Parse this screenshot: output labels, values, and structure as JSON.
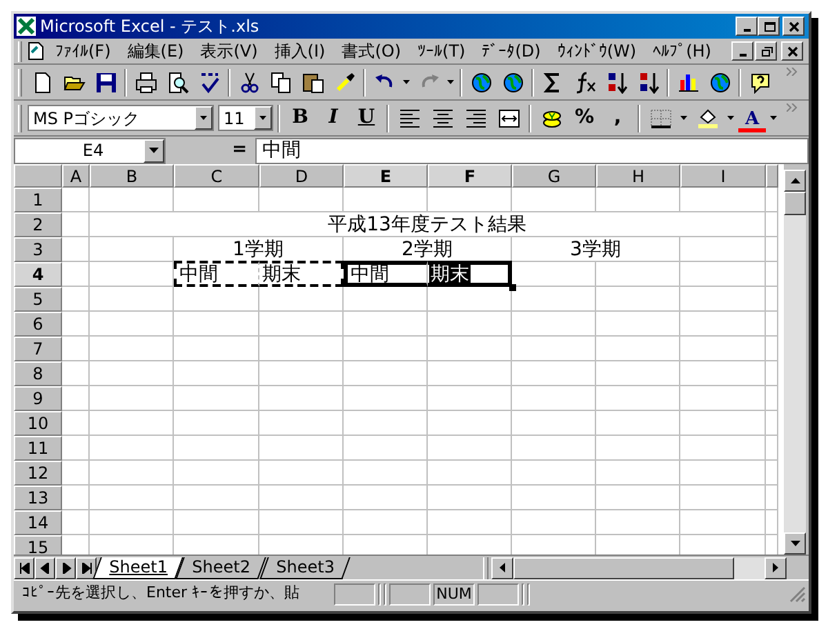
{
  "window": {
    "title": "Microsoft Excel - テスト.xls"
  },
  "menu": [
    {
      "label": "ﾌｧｲﾙ(F)"
    },
    {
      "label": "編集(E)"
    },
    {
      "label": "表示(V)"
    },
    {
      "label": "挿入(I)"
    },
    {
      "label": "書式(O)"
    },
    {
      "label": "ﾂｰﾙ(T)"
    },
    {
      "label": "ﾃﾞｰﾀ(D)"
    },
    {
      "label": "ｳｨﾝﾄﾞｳ(W)"
    },
    {
      "label": "ﾍﾙﾌﾟ(H)"
    }
  ],
  "formatting": {
    "font": "MS Pゴシック",
    "size": "11",
    "style_buttons": [
      {
        "kind": "bold",
        "label": "B"
      },
      {
        "kind": "italic",
        "label": "I"
      },
      {
        "kind": "underline",
        "label": "U"
      }
    ],
    "number_buttons": [
      {
        "label": "%"
      },
      {
        "label": ","
      }
    ],
    "font_color_label": "A"
  },
  "formula_bar": {
    "name_box": "E4",
    "equals": "=",
    "value": "中間"
  },
  "columns": [
    {
      "label": "A",
      "selected": false
    },
    {
      "label": "B",
      "selected": false
    },
    {
      "label": "C",
      "selected": false
    },
    {
      "label": "D",
      "selected": false
    },
    {
      "label": "E",
      "selected": true
    },
    {
      "label": "F",
      "selected": true
    },
    {
      "label": "G",
      "selected": false
    },
    {
      "label": "H",
      "selected": false
    },
    {
      "label": "I",
      "selected": false
    }
  ],
  "rows": [
    {
      "label": "1",
      "selected": false
    },
    {
      "label": "2",
      "selected": false
    },
    {
      "label": "3",
      "selected": false
    },
    {
      "label": "4",
      "selected": true
    },
    {
      "label": "5",
      "selected": false
    },
    {
      "label": "6",
      "selected": false
    },
    {
      "label": "7",
      "selected": false
    },
    {
      "label": "8",
      "selected": false
    },
    {
      "label": "9",
      "selected": false
    },
    {
      "label": "10",
      "selected": false
    },
    {
      "label": "11",
      "selected": false
    },
    {
      "label": "12",
      "selected": false
    },
    {
      "label": "13",
      "selected": false
    },
    {
      "label": "14",
      "selected": false
    },
    {
      "label": "15",
      "selected": false
    }
  ],
  "cells": [
    {
      "text": "平成13年度テスト結果",
      "highlighted": false
    },
    {
      "text": "1学期",
      "highlighted": false
    },
    {
      "text": "2学期",
      "highlighted": false
    },
    {
      "text": "3学期",
      "highlighted": false
    },
    {
      "text": "中間",
      "copied": true,
      "highlighted": false
    },
    {
      "text": "期末",
      "copied": true,
      "highlighted": false
    },
    {
      "text": "中間",
      "selected": true,
      "highlighted": false
    },
    {
      "text": "期末",
      "selected": true,
      "highlighted": true
    }
  ],
  "sheet_tabs": [
    {
      "label": "Sheet1",
      "selected": true
    },
    {
      "label": "Sheet2",
      "selected": false
    },
    {
      "label": "Sheet3",
      "selected": false
    }
  ],
  "status_bar": {
    "message": "ｺﾋﾟｰ先を選択し、Enter ｷｰを押すか、貼",
    "indicator": "NUM"
  }
}
